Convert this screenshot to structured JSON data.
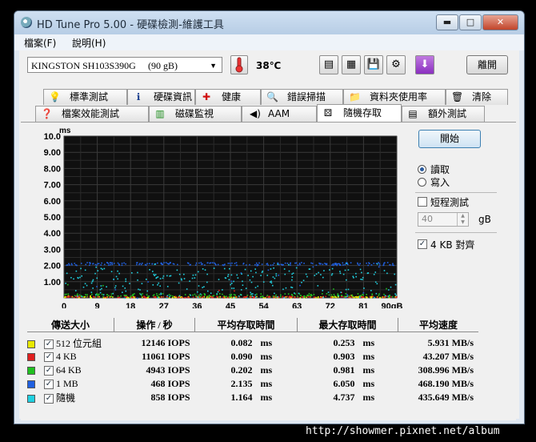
{
  "window": {
    "title": "HD Tune Pro  5.00 - 硬碟檢測-維護工具",
    "controls": {
      "minimize": "▬",
      "maximize": "□",
      "close": "✕"
    }
  },
  "menu": {
    "file": "檔案(F)",
    "help": "說明(H)"
  },
  "toolbar": {
    "drive_name": "KINGSTON SH103S390G",
    "drive_capacity": "(90 gB)",
    "temperature": "38℃",
    "exit_label": "離開",
    "icons": [
      "copy-text-icon",
      "copy-screenshot-icon",
      "save-icon",
      "options-icon",
      "download-icon"
    ]
  },
  "tabs_row1": [
    {
      "label": "標準測試",
      "icon": "benchmark-icon",
      "glyph": "💡"
    },
    {
      "label": "硬碟資訊",
      "icon": "info-icon",
      "glyph": "ℹ"
    },
    {
      "label": "健康",
      "icon": "health-icon",
      "glyph": "✚"
    },
    {
      "label": "錯誤掃描",
      "icon": "magnifier-icon",
      "glyph": "🔍"
    },
    {
      "label": "資料夾使用率",
      "icon": "folder-icon",
      "glyph": "📁"
    },
    {
      "label": "清除",
      "icon": "trash-icon",
      "glyph": "🗑"
    }
  ],
  "tabs_row2": [
    {
      "label": "檔案效能測試",
      "icon": "file-benchmark-icon",
      "glyph": "❓"
    },
    {
      "label": "磁碟監視",
      "icon": "monitor-icon",
      "glyph": "▥"
    },
    {
      "label": "AAM",
      "icon": "speaker-icon",
      "glyph": "◀)"
    },
    {
      "label": "隨機存取",
      "icon": "random-access-icon",
      "glyph": "⚄",
      "active": true
    },
    {
      "label": "額外測試",
      "icon": "extra-tests-icon",
      "glyph": "▤"
    }
  ],
  "controls": {
    "start_label": "開始",
    "read_label": "讀取",
    "write_label": "寫入",
    "short_stroke_label": "短程測試",
    "short_stroke_value": "40",
    "short_stroke_unit": "gB",
    "align_label": "4 KB 對齊",
    "align_checked": true,
    "mode": "read"
  },
  "chart_data": {
    "type": "scatter",
    "ylabel": "ms",
    "xlabel": "",
    "y_ticks": [
      "10.0",
      "9.00",
      "8.00",
      "7.00",
      "6.00",
      "5.00",
      "4.00",
      "3.00",
      "2.00",
      "1.00"
    ],
    "x_ticks": [
      "0",
      "9",
      "18",
      "27",
      "36",
      "45",
      "54",
      "63",
      "72",
      "81",
      "90gB"
    ],
    "ylim": [
      0,
      10
    ],
    "xlim": [
      0,
      90
    ],
    "grid": true,
    "series": [
      {
        "name": "512 位元組",
        "color": "#e8e800",
        "avg_ms": 0.082,
        "max_ms": 0.253
      },
      {
        "name": "4 KB",
        "color": "#e02020",
        "avg_ms": 0.09,
        "max_ms": 0.903
      },
      {
        "name": "64 KB",
        "color": "#20c020",
        "avg_ms": 0.202,
        "max_ms": 0.981
      },
      {
        "name": "1 MB",
        "color": "#2060e0",
        "avg_ms": 2.135,
        "max_ms": 6.05
      },
      {
        "name": "隨機",
        "color": "#20d0e0",
        "avg_ms": 1.164,
        "max_ms": 4.737
      }
    ]
  },
  "results": {
    "headers": [
      "傳送大小",
      "操作 / 秒",
      "平均存取時間",
      "最大存取時間",
      "平均速度"
    ],
    "rows": [
      {
        "size": "512 位元組",
        "color": "#e8e800",
        "ops": "12146 IOPS",
        "avg": "0.082",
        "max": "0.253",
        "speed": "5.931 MB/s"
      },
      {
        "size": "4 KB",
        "color": "#e02020",
        "ops": "11061 IOPS",
        "avg": "0.090",
        "max": "0.903",
        "speed": "43.207 MB/s"
      },
      {
        "size": "64 KB",
        "color": "#20c020",
        "ops": "4943 IOPS",
        "avg": "0.202",
        "max": "0.981",
        "speed": "308.996 MB/s"
      },
      {
        "size": "1 MB",
        "color": "#2060e0",
        "ops": "468 IOPS",
        "avg": "2.135",
        "max": "6.050",
        "speed": "468.190 MB/s"
      },
      {
        "size": "隨機",
        "color": "#20d0e0",
        "ops": "858 IOPS",
        "avg": "1.164",
        "max": "4.737",
        "speed": "435.649 MB/s"
      }
    ],
    "time_unit": "ms"
  },
  "watermark": "http://showmer.pixnet.net/album"
}
